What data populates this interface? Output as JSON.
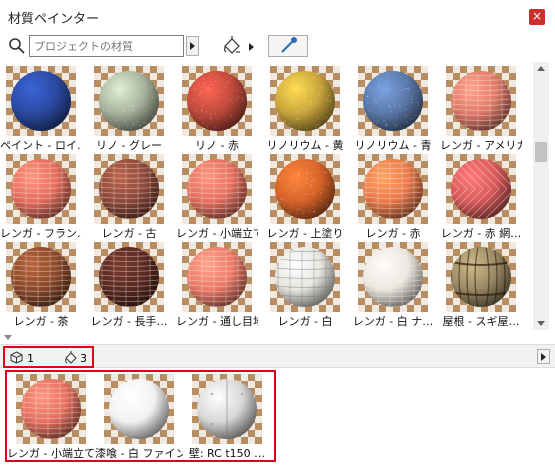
{
  "window": {
    "title": "材質ペインター",
    "close_glyph": "×"
  },
  "toolbar": {
    "search_placeholder": "プロジェクトの材質"
  },
  "materials": [
    {
      "label": "ペイント - ロイ…",
      "style": "sphere",
      "color": "#2b4aa0",
      "pattern": "smooth"
    },
    {
      "label": "リノ - グレー",
      "style": "sphere",
      "color": "#a7b29c",
      "pattern": "speckle"
    },
    {
      "label": "リノ - 赤",
      "style": "sphere",
      "color": "#c04a3c",
      "pattern": "speckle"
    },
    {
      "label": "リノリウム - 黄",
      "style": "sphere",
      "color": "#c9a43c",
      "pattern": "speckle"
    },
    {
      "label": "リノリウム - 青",
      "style": "sphere",
      "color": "#5a78a8",
      "pattern": "speckle"
    },
    {
      "label": "レンガ - アメリカ…",
      "style": "sphere",
      "color": "#e07a6a",
      "pattern": "brick"
    },
    {
      "label": "レンガ - フラン…",
      "style": "sphere",
      "color": "#e56e5e",
      "pattern": "brick"
    },
    {
      "label": "レンガ - 古",
      "style": "sphere",
      "color": "#8c4a3a",
      "pattern": "brick"
    },
    {
      "label": "レンガ - 小端立て",
      "style": "sphere",
      "color": "#e47060",
      "pattern": "brick"
    },
    {
      "label": "レンガ - 上塗り",
      "style": "sphere",
      "color": "#d7632a",
      "pattern": "speckle"
    },
    {
      "label": "レンガ - 赤",
      "style": "sphere",
      "color": "#ea7a4a",
      "pattern": "brick"
    },
    {
      "label": "レンガ - 赤 網…",
      "style": "sphere",
      "color": "#d85a5a",
      "pattern": "herring"
    },
    {
      "label": "レンガ - 茶",
      "style": "sphere",
      "color": "#8a4a2c",
      "pattern": "brick"
    },
    {
      "label": "レンガ - 長手…",
      "style": "sphere",
      "color": "#5a2a22",
      "pattern": "brick"
    },
    {
      "label": "レンガ - 通し目地",
      "style": "sphere",
      "color": "#ec7a68",
      "pattern": "brick"
    },
    {
      "label": "レンガ - 白",
      "style": "sphere",
      "color": "#e8e6e2",
      "pattern": "block"
    },
    {
      "label": "レンガ - 白 ナ…",
      "style": "sphere",
      "color": "#eae6e0",
      "pattern": "brick"
    },
    {
      "label": "屋根 - スギ屋…",
      "style": "sphere",
      "color": "#9a8a66",
      "pattern": "barrel"
    }
  ],
  "status": {
    "elements_count": "1",
    "materials_count": "3"
  },
  "used_materials": [
    {
      "label": "レンガ - 小端立て",
      "color": "#e47060",
      "pattern": "brick"
    },
    {
      "label": "漆喰 - 白 ファイン",
      "color": "#f2f2f2",
      "pattern": "speckle"
    },
    {
      "label": "壁: RC t150 …",
      "color": "#d8d8d6",
      "pattern": "panel"
    }
  ]
}
